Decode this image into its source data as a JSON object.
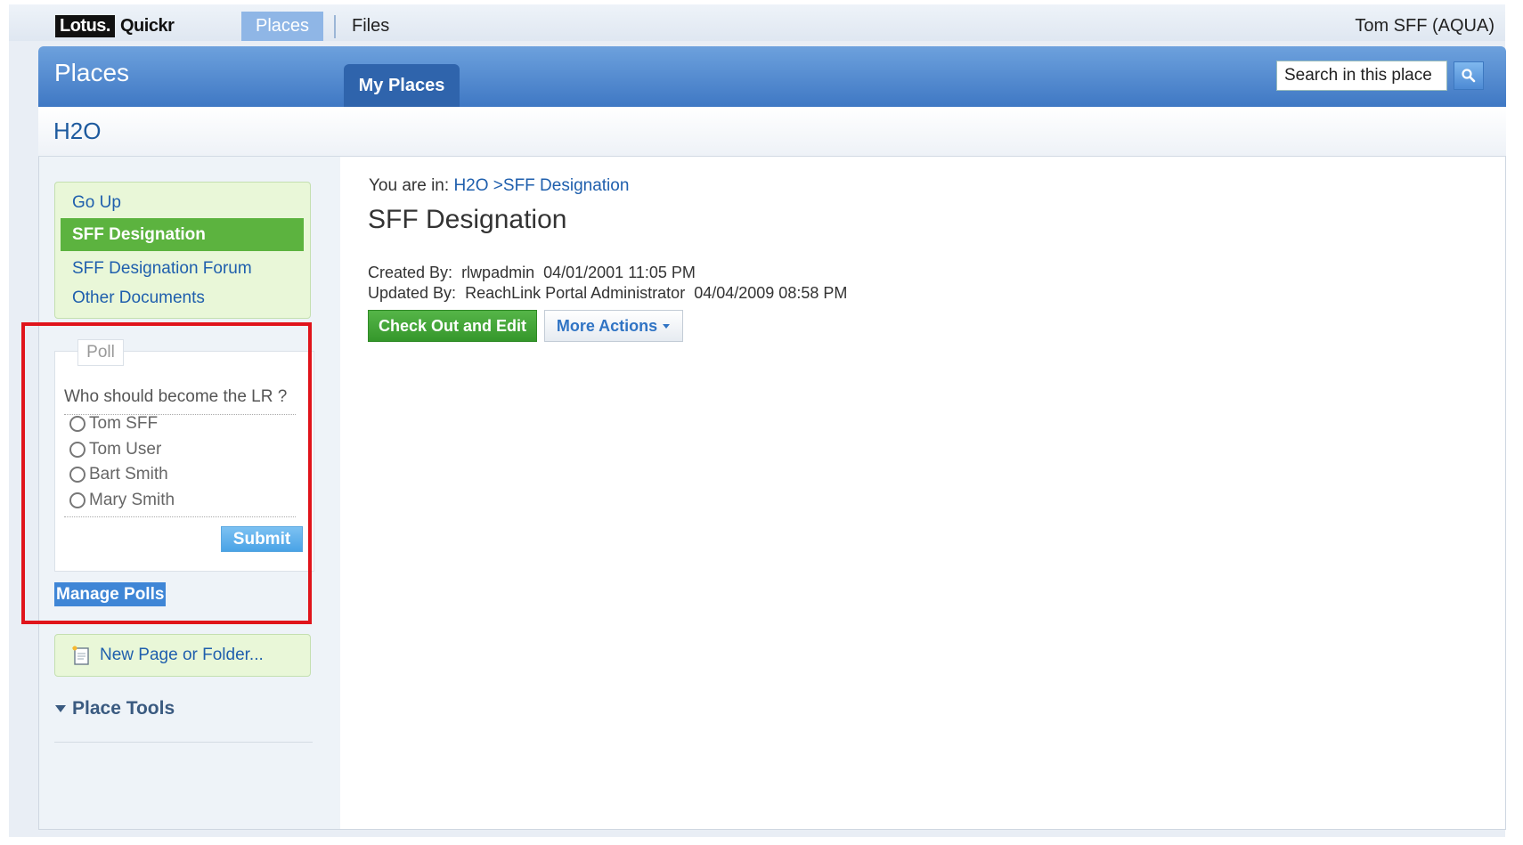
{
  "topbar": {
    "logo_brand": "Lotus.",
    "logo_product": "Quickr",
    "nav": [
      {
        "label": "Places"
      },
      {
        "label": "Files"
      }
    ],
    "user": "Tom SFF (AQUA)"
  },
  "banner": {
    "title": "Places",
    "tab": "My Places",
    "search_placeholder": "Search in this place",
    "search_icon": "search-icon"
  },
  "place": {
    "title": "H2O"
  },
  "sidebar": {
    "nav_items": [
      {
        "label": "Go Up"
      },
      {
        "label": "SFF Designation",
        "active": true
      },
      {
        "label": "SFF Designation Forum"
      },
      {
        "label": "Other Documents"
      }
    ],
    "poll": {
      "legend": "Poll",
      "question": "Who should become the LR ?",
      "options": [
        "Tom SFF",
        "Tom User",
        "Bart Smith",
        "Mary Smith"
      ],
      "submit_label": "Submit"
    },
    "manage_polls": "Manage Polls",
    "new_page": "New Page or Folder...",
    "place_tools": "Place Tools"
  },
  "main": {
    "breadcrumb_prefix": "You are in:",
    "breadcrumb": [
      "H2O",
      ">SFF Designation"
    ],
    "heading": "SFF Designation",
    "created_label": "Created By:",
    "created_by": "rlwpadmin",
    "created_date": "04/01/2001 11:05 PM",
    "updated_label": "Updated By:",
    "updated_by": "ReachLink Portal Administrator",
    "updated_date": "04/04/2009 08:58 PM",
    "checkout_label": "Check Out and Edit",
    "more_actions_label": "More Actions"
  },
  "colors": {
    "banner": "#3f78c4",
    "active_nav": "#5cb33f",
    "highlight": "#e0141b",
    "link": "#1f5fad"
  }
}
